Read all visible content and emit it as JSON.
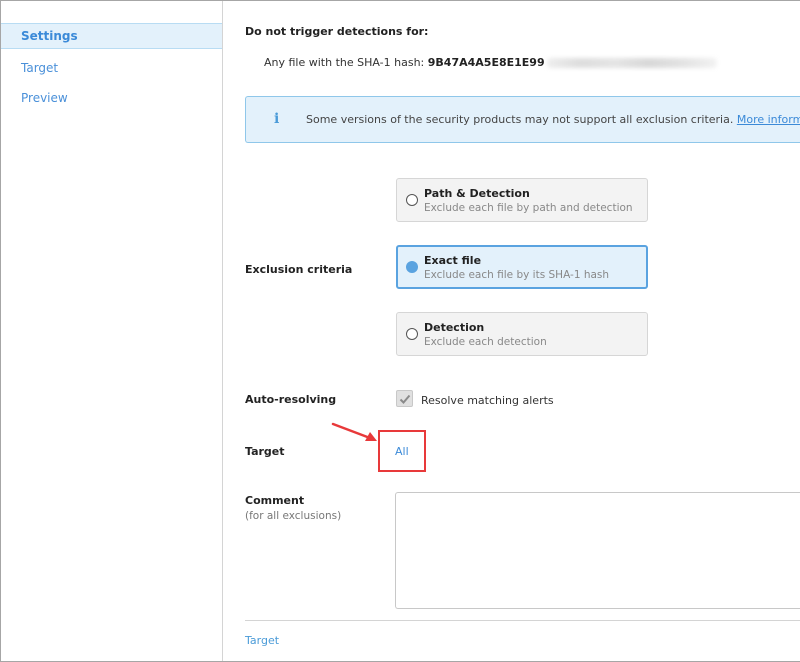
{
  "sidebar": {
    "items": [
      {
        "label": "Settings",
        "active": true
      },
      {
        "label": "Target",
        "active": false
      },
      {
        "label": "Preview",
        "active": false
      }
    ]
  },
  "main": {
    "heading": "Do not trigger detections for:",
    "hash_prefix": "Any file with the SHA-1 hash:",
    "hash_value": "9B47A4A5E8E1E99",
    "info": {
      "icon": "info-icon",
      "text": "Some versions of the security products may not support all exclusion criteria.",
      "link": "More information"
    },
    "exclusion": {
      "label": "Exclusion criteria",
      "options": [
        {
          "title": "Path & Detection",
          "description": "Exclude each file by path and detection",
          "selected": false
        },
        {
          "title": "Exact file",
          "description": "Exclude each file by its SHA-1 hash",
          "selected": true
        },
        {
          "title": "Detection",
          "description": "Exclude each detection",
          "selected": false
        }
      ]
    },
    "auto_resolving": {
      "label": "Auto-resolving",
      "checkbox_label": "Resolve matching alerts",
      "checked": true
    },
    "target": {
      "label": "Target",
      "value": "All"
    },
    "comment": {
      "label": "Comment",
      "sublabel": "(for all exclusions)",
      "value": ""
    },
    "footer_link": "Target"
  },
  "colors": {
    "accent": "#3b8ad8",
    "highlight": "#e8393a",
    "info_bg": "#e3f1fb"
  }
}
